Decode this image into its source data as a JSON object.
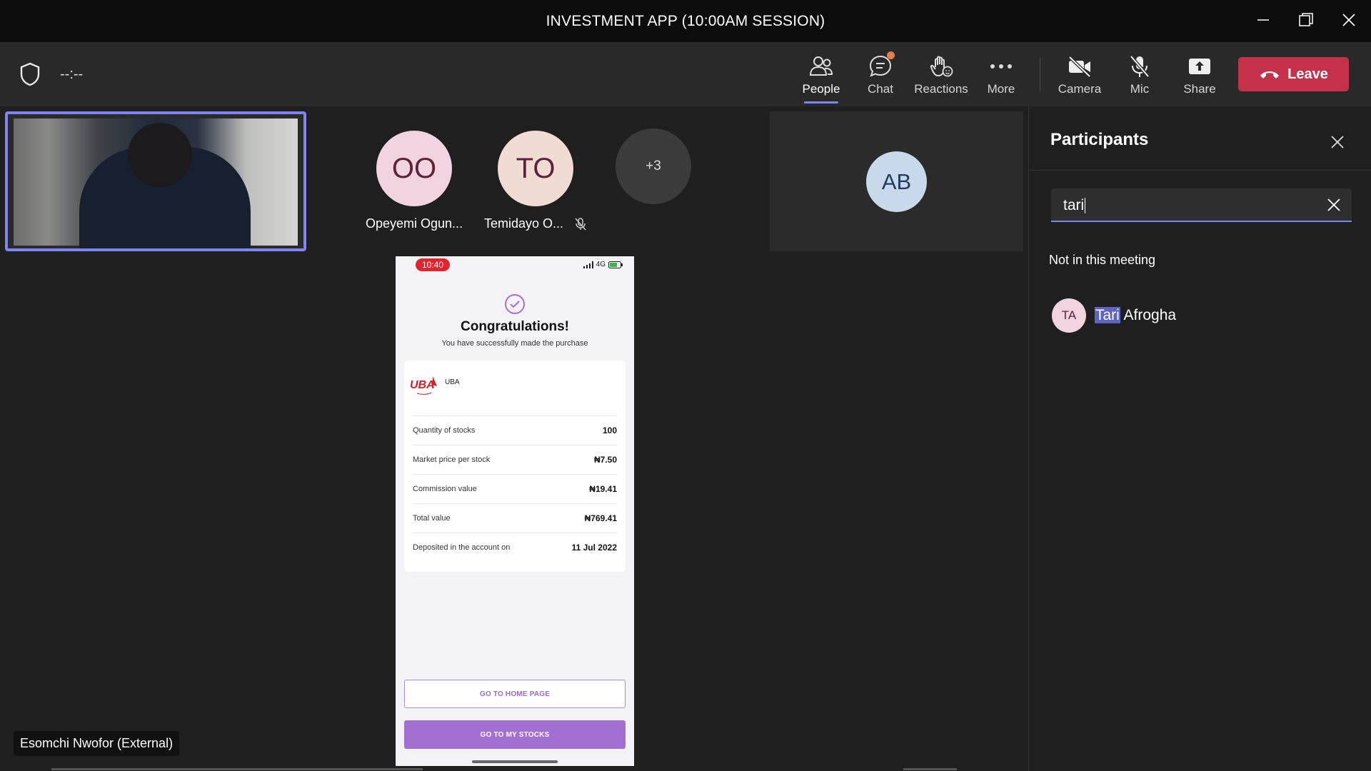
{
  "window": {
    "title": "INVESTMENT APP (10:00AM SESSION)"
  },
  "toolbar": {
    "timer": "--:--",
    "people_label": "People",
    "chat_label": "Chat",
    "reactions_label": "Reactions",
    "more_label": "More",
    "camera_label": "Camera",
    "mic_label": "Mic",
    "share_label": "Share",
    "leave_label": "Leave"
  },
  "colors": {
    "accent": "#7f85f5",
    "leave": "#c4314b",
    "notification": "#e37d4a",
    "phone_accent": "#a46fd3"
  },
  "gallery": {
    "participants": [
      {
        "initials": "OO",
        "name": "Opeyemi Ogun...",
        "muted": false,
        "color": "#f2d4e0"
      },
      {
        "initials": "TO",
        "name": "Temidayo O...",
        "muted": true,
        "color": "#f1dcd4"
      }
    ],
    "overflow": "+3",
    "featured_initials": "AB"
  },
  "screen_share": {
    "status_time": "10:40",
    "network": "4G",
    "title": "Congratulations!",
    "subtitle": "You have successfully made the purchase",
    "stock_name": "UBA",
    "rows": [
      {
        "label": "Quantity of stocks",
        "value": "100"
      },
      {
        "label": "Market price per stock",
        "value": "₦7.50"
      },
      {
        "label": "Commission value",
        "value": "₦19.41"
      },
      {
        "label": "Total value",
        "value": "₦769.41"
      },
      {
        "label": "Deposited in the account on",
        "value": "11 Jul 2022"
      }
    ],
    "home_button": "GO TO HOME PAGE",
    "stocks_button": "GO TO MY STOCKS"
  },
  "self_view": {
    "name_tag": "Esomchi Nwofor (External)"
  },
  "panel": {
    "title": "Participants",
    "search_value": "tari",
    "section": "Not in this meeting",
    "result": {
      "initials": "TA",
      "match": "Tari",
      "rest": " Afrogha"
    }
  }
}
